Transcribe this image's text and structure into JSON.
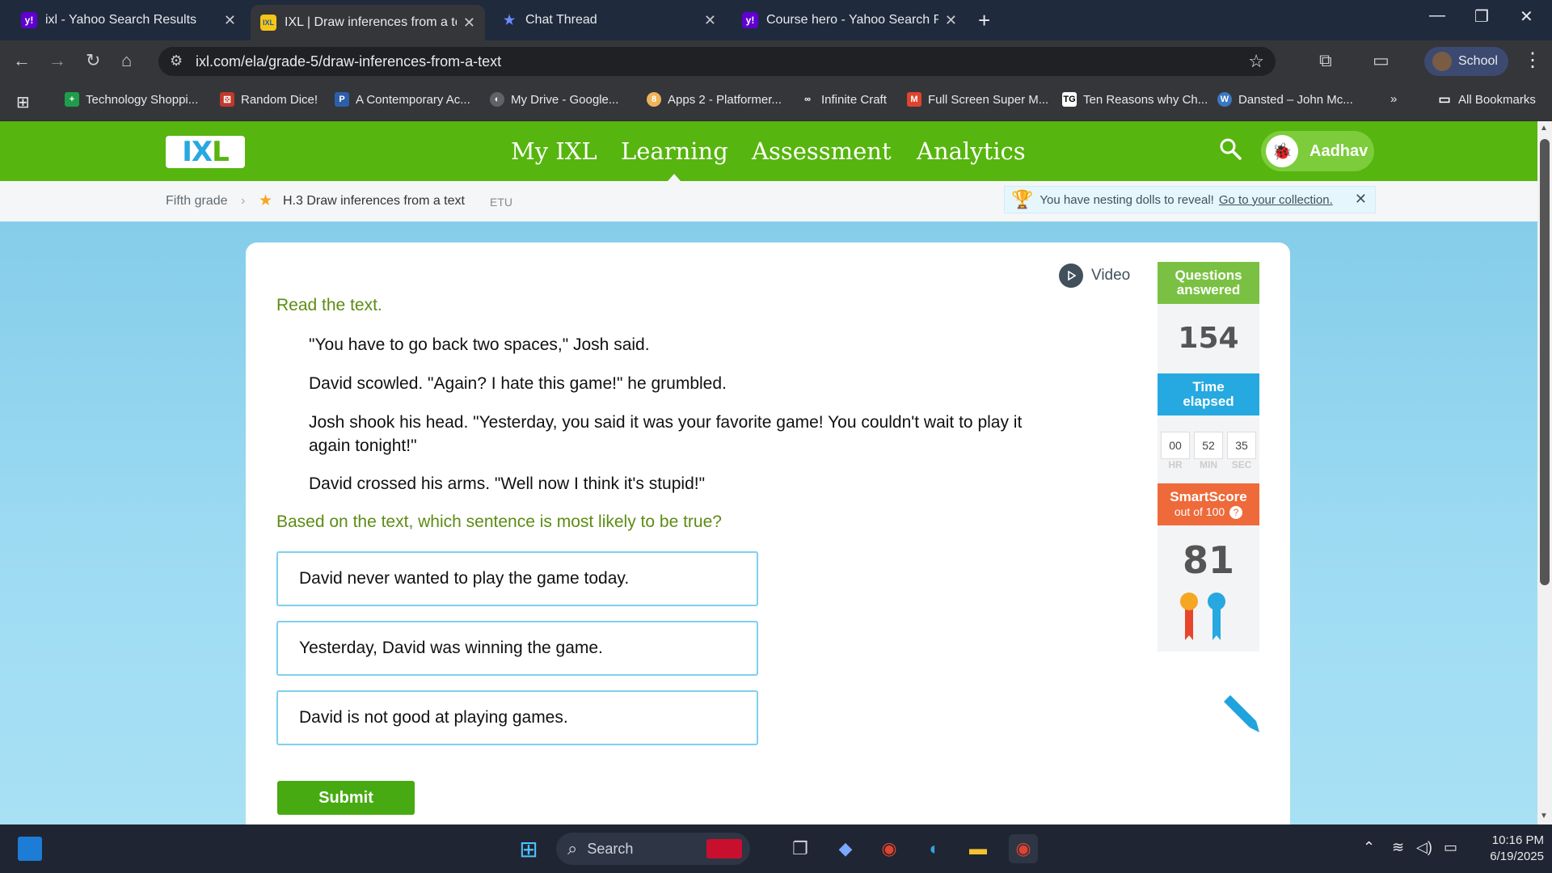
{
  "browser": {
    "tabs": [
      {
        "title": "ixl - Yahoo Search Results",
        "favicon": "yahoo-icon"
      },
      {
        "title": "IXL | Draw inferences from a tex",
        "favicon": "ixl-icon"
      },
      {
        "title": "Chat Thread",
        "favicon": "star-icon"
      },
      {
        "title": "Course hero - Yahoo Search Re",
        "favicon": "yahoo-icon"
      }
    ],
    "url": "ixl.com/ela/grade-5/draw-inferences-from-a-text",
    "profile_label": "School",
    "bookmarks": [
      "Technology Shoppi...",
      "Random Dice!",
      "A Contemporary Ac...",
      "My Drive - Google...",
      "Apps 2 - Platformer...",
      "Infinite Craft",
      "Full Screen Super M...",
      "Ten Reasons why Ch...",
      "Dansted – John Mc...",
      "All Bookmarks"
    ],
    "bookmark_overflow": "»"
  },
  "ixl": {
    "logo": [
      "I",
      "X",
      "L"
    ],
    "nav": [
      "My IXL",
      "Learning",
      "Assessment",
      "Analytics"
    ],
    "active_nav": "Learning",
    "user_name": "Aadhav",
    "breadcrumb": {
      "grade": "Fifth grade",
      "skill": "H.3 Draw inferences from a text",
      "code": "ETU"
    },
    "notice": {
      "text": "You have nesting dolls to reveal!",
      "link": "Go to your collection."
    },
    "video_label": "Video",
    "instruction": "Read the text.",
    "passage": [
      "\"You have to go back two spaces,\" Josh said.",
      "David scowled. \"Again? I hate this game!\" he grumbled.",
      "Josh shook his head. \"Yesterday, you said it was your favorite game! You couldn't wait to play it again tonight!\"",
      "David crossed his arms. \"Well now I think it's stupid!\""
    ],
    "question": "Based on the text, which sentence is most likely to be true?",
    "choices": [
      "David never wanted to play the game today.",
      "Yesterday, David was winning the game.",
      "David is not good at playing games."
    ],
    "submit_label": "Submit",
    "stats": {
      "questions_label_1": "Questions",
      "questions_label_2": "answered",
      "questions_answered": "154",
      "time_label_1": "Time",
      "time_label_2": "elapsed",
      "time": {
        "hr": "00",
        "min": "52",
        "sec": "35"
      },
      "time_units": {
        "hr": "HR",
        "min": "MIN",
        "sec": "SEC"
      },
      "smartscore_label": "SmartScore",
      "smartscore_sub": "out of 100",
      "smartscore": "81"
    },
    "colors": {
      "header_green": "#56b50e",
      "time_blue": "#25a9e0",
      "smartscore_orange": "#ee6a3a",
      "question_green": "#5d8c13"
    }
  },
  "taskbar": {
    "search_placeholder": "Search",
    "time": "10:16 PM",
    "date": "6/19/2025"
  }
}
